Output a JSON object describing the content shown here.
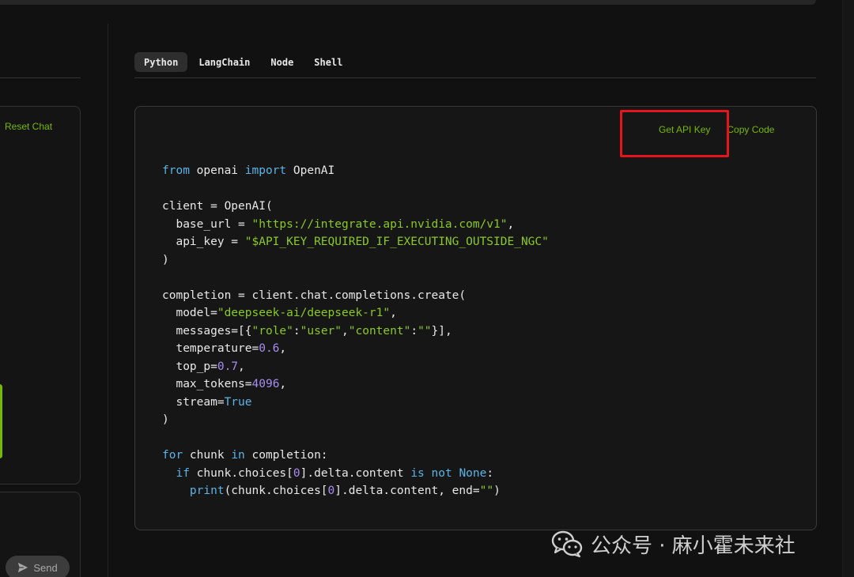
{
  "sidebar": {
    "reset_chat_label": "Reset Chat",
    "send_label": "Send"
  },
  "tabs": [
    {
      "label": "Python",
      "active": true
    },
    {
      "label": "LangChain",
      "active": false
    },
    {
      "label": "Node",
      "active": false
    },
    {
      "label": "Shell",
      "active": false
    }
  ],
  "code_card": {
    "get_api_key_label": "Get API Key",
    "copy_code_label": "Copy Code",
    "lines": [
      [
        [
          "kw",
          "from"
        ],
        [
          "plain",
          " openai "
        ],
        [
          "kw",
          "import"
        ],
        [
          "plain",
          " OpenAI"
        ]
      ],
      [],
      [
        [
          "plain",
          "client = OpenAI("
        ]
      ],
      [
        [
          "plain",
          "  base_url = "
        ],
        [
          "str",
          "\"https://integrate.api.nvidia.com/v1\""
        ],
        [
          "plain",
          ","
        ]
      ],
      [
        [
          "plain",
          "  api_key = "
        ],
        [
          "str",
          "\"$API_KEY_REQUIRED_IF_EXECUTING_OUTSIDE_NGC\""
        ]
      ],
      [
        [
          "plain",
          ")"
        ]
      ],
      [],
      [
        [
          "plain",
          "completion = client.chat.completions.create("
        ]
      ],
      [
        [
          "plain",
          "  model="
        ],
        [
          "str",
          "\"deepseek-ai/deepseek-r1\""
        ],
        [
          "plain",
          ","
        ]
      ],
      [
        [
          "plain",
          "  messages=[{"
        ],
        [
          "str",
          "\"role\""
        ],
        [
          "plain",
          ":"
        ],
        [
          "str",
          "\"user\""
        ],
        [
          "plain",
          ","
        ],
        [
          "str",
          "\"content\""
        ],
        [
          "plain",
          ":"
        ],
        [
          "str",
          "\"\""
        ],
        [
          "plain",
          "}],"
        ]
      ],
      [
        [
          "plain",
          "  temperature="
        ],
        [
          "num",
          "0.6"
        ],
        [
          "plain",
          ","
        ]
      ],
      [
        [
          "plain",
          "  top_p="
        ],
        [
          "num",
          "0.7"
        ],
        [
          "plain",
          ","
        ]
      ],
      [
        [
          "plain",
          "  max_tokens="
        ],
        [
          "num",
          "4096"
        ],
        [
          "plain",
          ","
        ]
      ],
      [
        [
          "plain",
          "  stream="
        ],
        [
          "kw",
          "True"
        ]
      ],
      [
        [
          "plain",
          ")"
        ]
      ],
      [],
      [
        [
          "kw",
          "for"
        ],
        [
          "plain",
          " chunk "
        ],
        [
          "kw",
          "in"
        ],
        [
          "plain",
          " completion:"
        ]
      ],
      [
        [
          "plain",
          "  "
        ],
        [
          "kw",
          "if"
        ],
        [
          "plain",
          " chunk.choices["
        ],
        [
          "num",
          "0"
        ],
        [
          "plain",
          "].delta.content "
        ],
        [
          "kw",
          "is not"
        ],
        [
          "plain",
          " "
        ],
        [
          "kw",
          "None"
        ],
        [
          "plain",
          ":"
        ]
      ],
      [
        [
          "plain",
          "    "
        ],
        [
          "kw",
          "print"
        ],
        [
          "plain",
          "(chunk.choices["
        ],
        [
          "num",
          "0"
        ],
        [
          "plain",
          "].delta.content, end="
        ],
        [
          "str",
          "\"\""
        ],
        [
          "plain",
          ")"
        ]
      ]
    ]
  },
  "watermark": {
    "text": "公众号 · 麻小霍未来社",
    "icon": "wechat-icon"
  },
  "colors": {
    "accent": "#76b900",
    "highlight": "#e5151d",
    "keyword": "#5ab4e6",
    "string": "#8ac926",
    "number": "#a98cf0"
  }
}
